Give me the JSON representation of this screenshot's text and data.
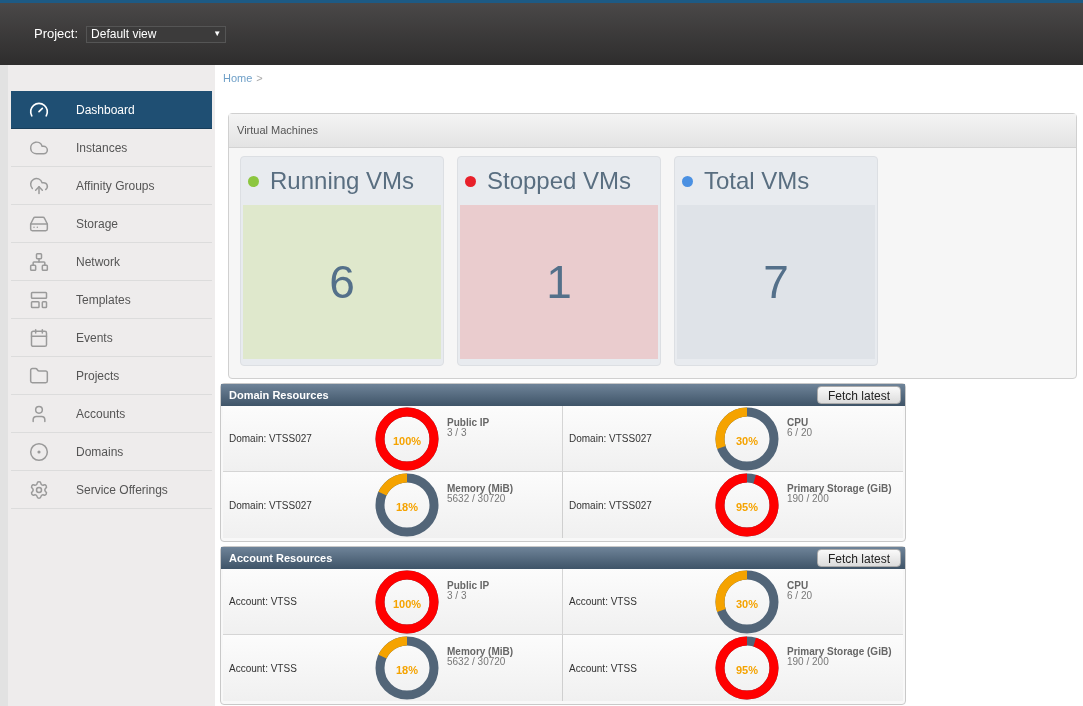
{
  "topbar": {
    "project_label": "Project:",
    "project_value": "Default view",
    "dropdown_arrow": "▼"
  },
  "sidebar": {
    "items": [
      {
        "label": "Dashboard",
        "selected": true
      },
      {
        "label": "Instances",
        "selected": false
      },
      {
        "label": "Affinity Groups",
        "selected": false
      },
      {
        "label": "Storage",
        "selected": false
      },
      {
        "label": "Network",
        "selected": false
      },
      {
        "label": "Templates",
        "selected": false
      },
      {
        "label": "Events",
        "selected": false
      },
      {
        "label": "Projects",
        "selected": false
      },
      {
        "label": "Accounts",
        "selected": false
      },
      {
        "label": "Domains",
        "selected": false
      },
      {
        "label": "Service Offerings",
        "selected": false
      }
    ]
  },
  "breadcrumb": {
    "items": [
      "Home"
    ],
    "separator": ">"
  },
  "virtual_machines": {
    "title": "Virtual Machines",
    "cards": [
      {
        "label": "Running VMs",
        "count": "6",
        "color": "#8cc63f"
      },
      {
        "label": "Stopped VMs",
        "count": "1",
        "color": "#e8202a"
      },
      {
        "label": "Total VMs",
        "count": "7",
        "color": "#4a90e2"
      }
    ]
  },
  "resource_panels": [
    {
      "title": "Domain Resources",
      "button": "Fetch latest",
      "cells": [
        {
          "owner": "Domain: VTSS027",
          "name": "Public IP",
          "usage": "3 / 3",
          "percent": "100%"
        },
        {
          "owner": "Domain: VTSS027",
          "name": "CPU",
          "usage": "6 / 20",
          "percent": "30%"
        },
        {
          "owner": "Domain: VTSS027",
          "name": "Memory (MiB)",
          "usage": "5632 / 30720",
          "percent": "18%"
        },
        {
          "owner": "Domain: VTSS027",
          "name": "Primary Storage (GiB)",
          "usage": "190 / 200",
          "percent": "95%"
        }
      ]
    },
    {
      "title": "Account Resources",
      "button": "Fetch latest",
      "cells": [
        {
          "owner": "Account: VTSS",
          "name": "Public IP",
          "usage": "3 / 3",
          "percent": "100%"
        },
        {
          "owner": "Account: VTSS",
          "name": "CPU",
          "usage": "6 / 20",
          "percent": "30%"
        },
        {
          "owner": "Account: VTSS",
          "name": "Memory (MiB)",
          "usage": "5632 / 30720",
          "percent": "18%"
        },
        {
          "owner": "Account: VTSS",
          "name": "Primary Storage (GiB)",
          "usage": "190 / 200",
          "percent": "95%"
        }
      ]
    }
  ]
}
